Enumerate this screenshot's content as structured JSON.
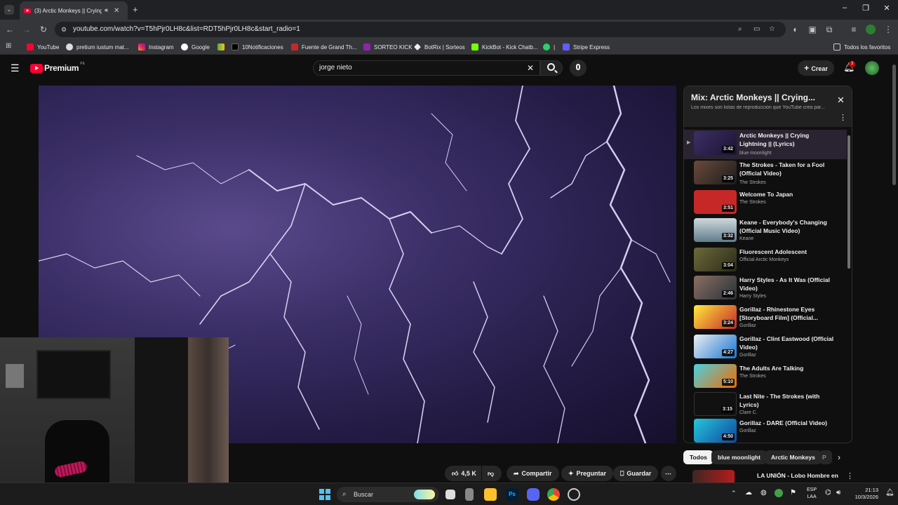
{
  "browser": {
    "tab_title": "(3) Arctic Monkeys || Crying",
    "url": "youtube.com/watch?v=T5hPjr0LH8c&list=RDT5hPjr0LH8c&start_radio=1",
    "bookmarks": [
      "YouTube",
      "pretium iustum mat...",
      "Instagram",
      "Google",
      "10Notificaciones",
      "Fuente de Grand Th...",
      "SORTEO KICK",
      "BotRix | Sorteos",
      "KickBot - Kick Chatb...",
      "|",
      "Stripe Express"
    ],
    "all_bookmarks": "Todos los favoritos"
  },
  "youtube": {
    "logo_text": "Premium",
    "logo_badge": "PE",
    "search_value": "jorge nieto",
    "create_label": "Crear",
    "notif_count": "3"
  },
  "actions": {
    "likes": "4,5 K",
    "share": "Compartir",
    "ask": "Preguntar",
    "save": "Guardar"
  },
  "playlist": {
    "title": "Mix: Arctic Monkeys || Crying...",
    "subtitle": "Los mixes son listas de reproducción que YouTube crea par...",
    "items": [
      {
        "title": "Arctic Monkeys || Crying Lightning || (Lyrics)",
        "channel": "blue moonlight",
        "duration": "3:42"
      },
      {
        "title": "The Strokes - Taken for a Fool (Official Video)",
        "channel": "The Strokes",
        "duration": "3:25"
      },
      {
        "title": "Welcome To Japan",
        "channel": "The Strokes",
        "duration": "3:51"
      },
      {
        "title": "Keane - Everybody's Changing (Official Music Video)",
        "channel": "Keane",
        "duration": "3:32"
      },
      {
        "title": "Fluorescent Adolescent",
        "channel": "Official Arctic Monkeys",
        "duration": "3:04"
      },
      {
        "title": "Harry Styles - As It Was (Official Video)",
        "channel": "Harry Styles",
        "duration": "2:46"
      },
      {
        "title": "Gorillaz - Rhinestone Eyes [Storyboard Film] (Official...",
        "channel": "Gorillaz",
        "duration": "3:24"
      },
      {
        "title": "Gorillaz - Clint Eastwood (Official Video)",
        "channel": "Gorillaz",
        "duration": "4:27"
      },
      {
        "title": "The Adults Are Talking",
        "channel": "The Strokes",
        "duration": "5:10"
      },
      {
        "title": "Last Nite - The Strokes (with Lyrics)",
        "channel": "Clare C.",
        "duration": "3:15"
      },
      {
        "title": "Gorillaz - DARE (Official Video)",
        "channel": "Gorillaz",
        "duration": "4:50"
      }
    ]
  },
  "chips": [
    "Todos",
    "blue moonlight",
    "Arctic Monkeys",
    "P"
  ],
  "next_video": {
    "title": "LA UNIÓN - Lobo Hombre en"
  },
  "taskbar": {
    "search_label": "Buscar",
    "lang": "ESP",
    "lang2": "LAA",
    "time": "21:13",
    "date": "10/3/2026"
  }
}
